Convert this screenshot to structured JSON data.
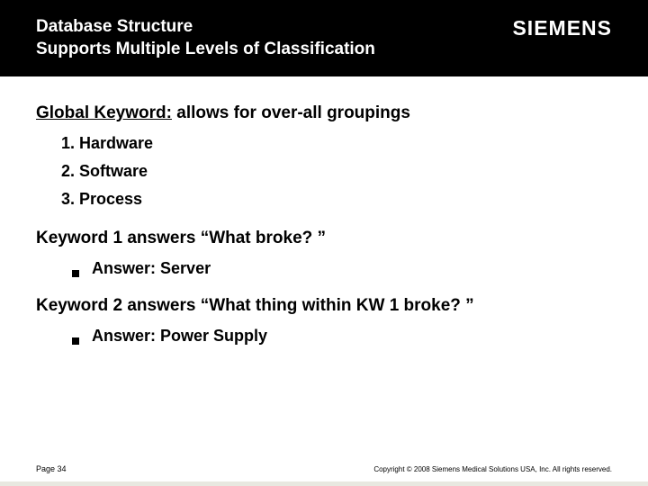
{
  "header": {
    "title_line1": "Database Structure",
    "title_line2": "Supports Multiple Levels of Classification",
    "logo": "SIEMENS"
  },
  "section1": {
    "heading_underlined": "Global Keyword:",
    "heading_rest": " allows for over-all groupings",
    "items": [
      "Hardware",
      "Software",
      "Process"
    ]
  },
  "section2": {
    "heading": "Keyword 1 answers “What broke? ”",
    "answer_label": "Answer: ",
    "answer_value": "Server"
  },
  "section3": {
    "heading": "Keyword 2 answers “What thing within KW 1 broke? ”",
    "answer_label": "Answer: ",
    "answer_value": "Power Supply"
  },
  "footer": {
    "page": "Page 34",
    "copyright": "Copyright © 2008 Siemens Medical Solutions USA, Inc. All rights reserved."
  }
}
